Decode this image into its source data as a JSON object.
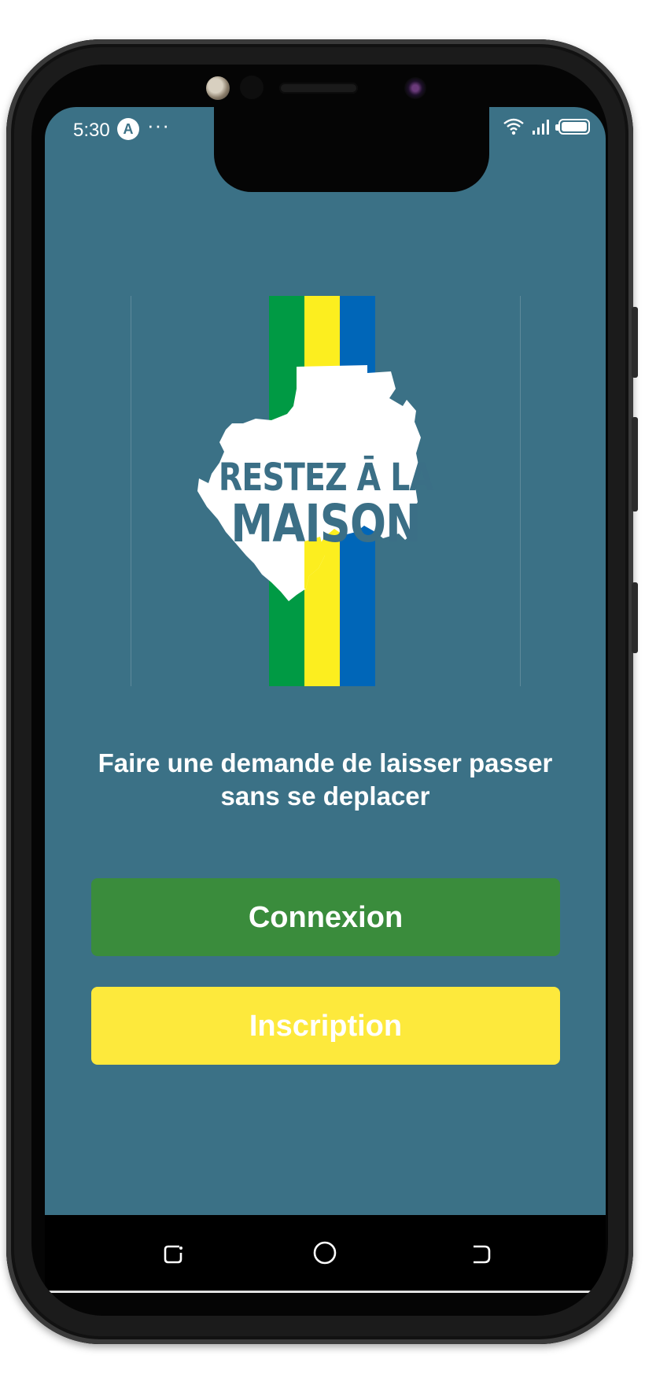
{
  "status_bar": {
    "time": "5:30",
    "app_icon_glyph": "A",
    "more_glyph": "···"
  },
  "logo": {
    "line1": "RESTEZ Ā LA",
    "line2": "MAISON",
    "stripe_colors": [
      "#009a44",
      "#fcee1f",
      "#0066b8"
    ]
  },
  "headline": {
    "line1": "Faire une demande de laisser passer",
    "line2": "sans se deplacer"
  },
  "buttons": {
    "connexion": "Connexion",
    "inscription": "Inscription"
  },
  "colors": {
    "screen_background": "#3b7186",
    "connexion_button": "#3a8c3c",
    "inscription_button": "#fde93c"
  },
  "nav": {
    "recent_icon": "recent-apps-icon",
    "home_icon": "home-icon",
    "back_icon": "back-icon"
  }
}
